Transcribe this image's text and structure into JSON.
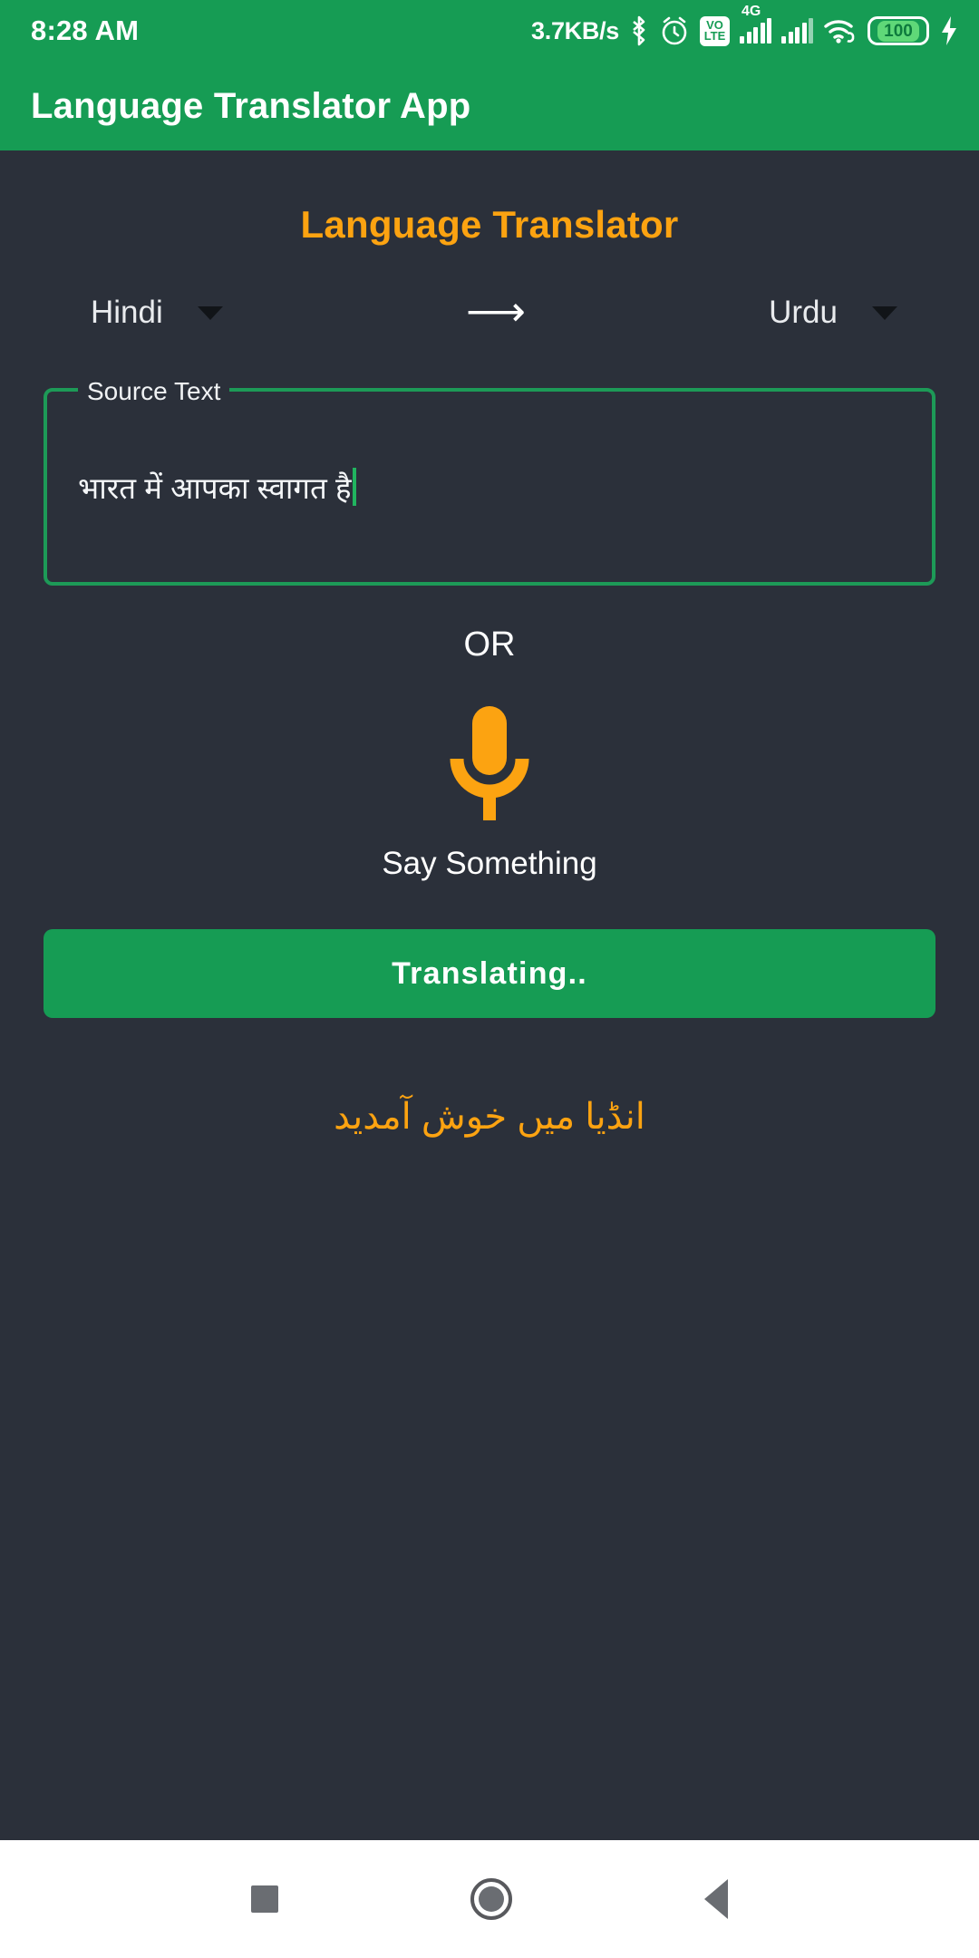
{
  "status_bar": {
    "time": "8:28 AM",
    "network_speed": "3.7KB/s",
    "bluetooth_icon": "bluetooth-icon",
    "alarm_icon": "alarm-icon",
    "volte_top": "VO",
    "volte_bottom": "LTE",
    "network_type": "4G",
    "wifi_icon": "wifi-icon",
    "battery_level": "100",
    "charging_icon": "charging-bolt-icon"
  },
  "app_bar": {
    "title": "Language Translator App"
  },
  "main": {
    "page_title": "Language Translator",
    "source_language": "Hindi",
    "target_language": "Urdu",
    "direction_arrow": "⟶",
    "source_field_label": "Source Text",
    "source_field_value": "भारत में आपका स्वागत है",
    "source_field_placeholder": "Source Text",
    "or_label": "OR",
    "mic_icon": "microphone-icon",
    "mic_caption": "Say Something",
    "translate_button_label": "Translating..",
    "translated_text": "انڈیا میں خوش آمدید"
  },
  "nav_bar": {
    "recents_icon": "recents-square-icon",
    "home_icon": "home-circle-icon",
    "back_icon": "back-triangle-icon"
  },
  "colors": {
    "brand_green": "#169c54",
    "accent_orange": "#fca311",
    "background_dark": "#2b303a",
    "field_border_green": "#1d9a57"
  }
}
